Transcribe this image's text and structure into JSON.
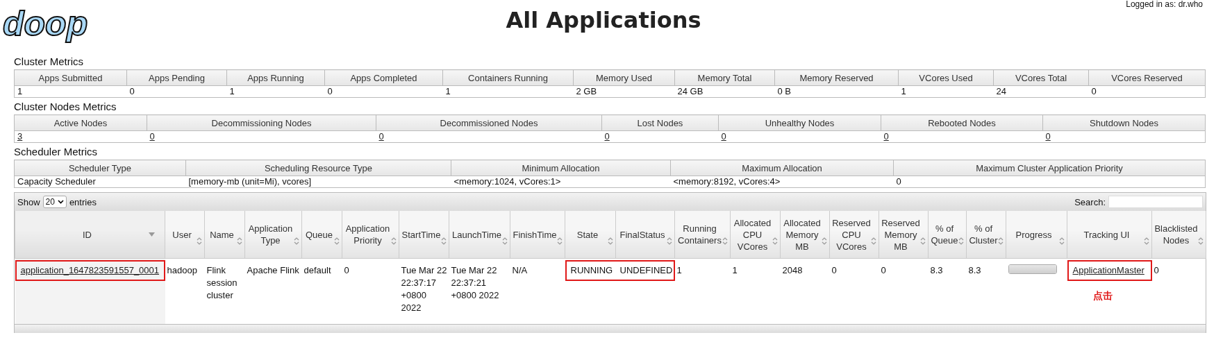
{
  "header": {
    "logo_text": "doop",
    "title": "All Applications",
    "login": "Logged in as: dr.who"
  },
  "metric_tables": [
    {
      "title": "Cluster Metrics",
      "links": false,
      "columns": [
        "Apps Submitted",
        "Apps Pending",
        "Apps Running",
        "Apps Completed",
        "Containers Running",
        "Memory Used",
        "Memory Total",
        "Memory Reserved",
        "VCores Used",
        "VCores Total",
        "VCores Reserved"
      ],
      "values": [
        "1",
        "0",
        "1",
        "0",
        "1",
        "2 GB",
        "24 GB",
        "0 B",
        "1",
        "24",
        "0"
      ]
    },
    {
      "title": "Cluster Nodes Metrics",
      "links": true,
      "columns": [
        "Active Nodes",
        "Decommissioning Nodes",
        "Decommissioned Nodes",
        "Lost Nodes",
        "Unhealthy Nodes",
        "Rebooted Nodes",
        "Shutdown Nodes"
      ],
      "values": [
        "3",
        "0",
        "0",
        "0",
        "0",
        "0",
        "0"
      ]
    },
    {
      "title": "Scheduler Metrics",
      "links": false,
      "columns": [
        "Scheduler Type",
        "Scheduling Resource Type",
        "Minimum Allocation",
        "Maximum Allocation",
        "Maximum Cluster Application Priority"
      ],
      "values": [
        "Capacity Scheduler",
        "[memory-mb (unit=Mi), vcores]",
        "<memory:1024, vCores:1>",
        "<memory:8192, vCores:4>",
        "0"
      ]
    }
  ],
  "apps": {
    "show_label": "Show",
    "page_size": "20",
    "entries_label": "entries",
    "search_label": "Search:",
    "columns": [
      {
        "label": "ID",
        "sorted": true
      },
      {
        "label": "User",
        "sorted": false
      },
      {
        "label": "Name",
        "sorted": false
      },
      {
        "label": "Application Type",
        "sorted": false
      },
      {
        "label": "Queue",
        "sorted": false
      },
      {
        "label": "Application Priority",
        "sorted": false
      },
      {
        "label": "StartTime",
        "sorted": false
      },
      {
        "label": "LaunchTime",
        "sorted": false
      },
      {
        "label": "FinishTime",
        "sorted": false
      },
      {
        "label": "State",
        "sorted": false
      },
      {
        "label": "FinalStatus",
        "sorted": false
      },
      {
        "label": "Running Containers",
        "sorted": false
      },
      {
        "label": "Allocated CPU VCores",
        "sorted": false
      },
      {
        "label": "Allocated Memory MB",
        "sorted": false
      },
      {
        "label": "Reserved CPU VCores",
        "sorted": false
      },
      {
        "label": "Reserved Memory MB",
        "sorted": false
      },
      {
        "label": "% of Queue",
        "sorted": false
      },
      {
        "label": "% of Cluster",
        "sorted": false
      },
      {
        "label": "Progress",
        "sorted": false
      },
      {
        "label": "Tracking UI",
        "sorted": false
      },
      {
        "label": "Blacklisted Nodes",
        "sorted": false
      }
    ],
    "rows": [
      {
        "cells": [
          {
            "kind": "link",
            "text": "application_1647823591557_0001",
            "boxed": true
          },
          {
            "kind": "text",
            "text": "hadoop",
            "boxed": false
          },
          {
            "kind": "text",
            "text": "Flink session cluster",
            "boxed": false
          },
          {
            "kind": "text",
            "text": "Apache Flink",
            "boxed": false
          },
          {
            "kind": "text",
            "text": "default",
            "boxed": false
          },
          {
            "kind": "text",
            "text": "0",
            "boxed": false
          },
          {
            "kind": "text",
            "text": "Tue Mar 22 22:37:17 +0800 2022",
            "boxed": false
          },
          {
            "kind": "text",
            "text": "Tue Mar 22 22:37:21 +0800 2022",
            "boxed": false
          },
          {
            "kind": "text",
            "text": "N/A",
            "boxed": false
          },
          {
            "kind": "text",
            "text": "RUNNING",
            "boxed": true
          },
          {
            "kind": "text",
            "text": "UNDEFINED",
            "boxed": true
          },
          {
            "kind": "text",
            "text": "1",
            "boxed": false
          },
          {
            "kind": "text",
            "text": "1",
            "boxed": false
          },
          {
            "kind": "text",
            "text": "2048",
            "boxed": false
          },
          {
            "kind": "text",
            "text": "0",
            "boxed": false
          },
          {
            "kind": "text",
            "text": "0",
            "boxed": false
          },
          {
            "kind": "text",
            "text": "8.3",
            "boxed": false
          },
          {
            "kind": "text",
            "text": "8.3",
            "boxed": false
          },
          {
            "kind": "progress",
            "level": 1,
            "boxed": false
          },
          {
            "kind": "link",
            "text": "ApplicationMaster",
            "boxed": true,
            "note": "点击"
          },
          {
            "kind": "text",
            "text": "0",
            "boxed": false
          }
        ]
      }
    ]
  }
}
